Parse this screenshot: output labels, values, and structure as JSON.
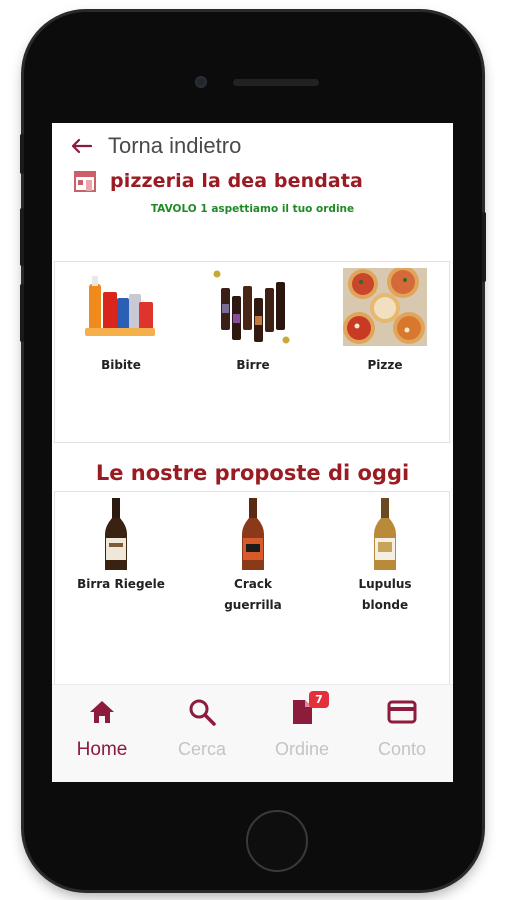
{
  "header": {
    "back_label": "Torna indietro",
    "restaurant_name": "pizzeria la dea bendata",
    "table_message": "TAVOLO 1 aspettiamo il tuo ordine"
  },
  "categories": [
    {
      "label": "Bibite",
      "icon": "soft-drinks-image"
    },
    {
      "label": "Birre",
      "icon": "beers-image"
    },
    {
      "label": "Pizze",
      "icon": "pizzas-image"
    }
  ],
  "proposals": {
    "title": "Le nostre proposte di oggi",
    "items": [
      {
        "line1": "Birra Riegele",
        "line2": ""
      },
      {
        "line1": "Crack",
        "line2": "guerrilla"
      },
      {
        "line1": "Lupulus",
        "line2": "blonde"
      }
    ]
  },
  "tabbar": {
    "tabs": [
      {
        "label": "Home",
        "icon": "home-icon",
        "active": true
      },
      {
        "label": "Cerca",
        "icon": "search-icon",
        "active": false
      },
      {
        "label": "Ordine",
        "icon": "document-icon",
        "active": false,
        "badge": "7"
      },
      {
        "label": "Conto",
        "icon": "credit-card-icon",
        "active": false
      }
    ]
  },
  "colors": {
    "brand": "#9a1b22",
    "accent": "#8c1b3c",
    "table_message": "#1e8b25",
    "inactive_tab": "#c4c4c4",
    "badge": "#e2313a"
  }
}
